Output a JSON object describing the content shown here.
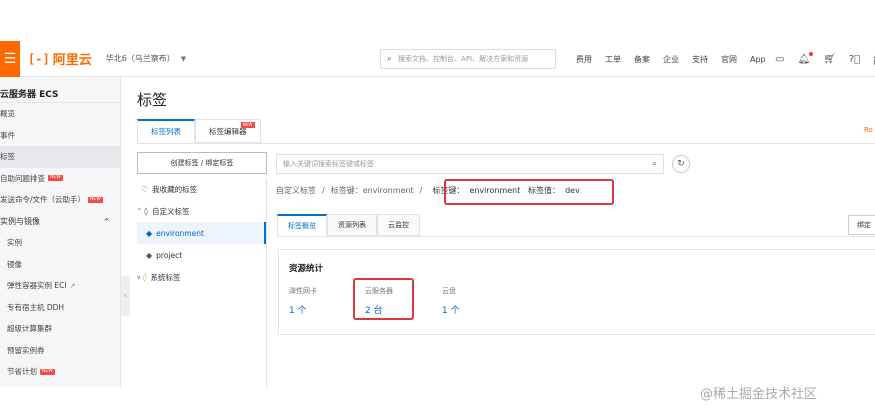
{
  "topbar": {
    "menu_icon": "hamburger-icon",
    "logo_mark": "[-]",
    "logo_text": "阿里云",
    "region": "华北6（乌兰察布）",
    "search_placeholder": "搜索文档、控制台、API、解决方案和资源",
    "links": [
      "费用",
      "工单",
      "备案",
      "企业",
      "支持",
      "官网",
      "App"
    ],
    "icons": [
      "screen-icon",
      "bell-icon",
      "cart-icon",
      "help-icon"
    ],
    "lang": "简"
  },
  "sidebar": {
    "title": "云服务器 ECS",
    "items": [
      {
        "label": "概览"
      },
      {
        "label": "事件"
      },
      {
        "label": "标签",
        "active": true
      },
      {
        "label": "自助问题排查",
        "badge": "NEW"
      },
      {
        "label": "发送命令/文件（云助手）",
        "badge": "NEW"
      }
    ],
    "group": {
      "label": "实例与镜像",
      "caret": "^"
    },
    "sub_items": [
      {
        "label": "实例"
      },
      {
        "label": "镜像"
      },
      {
        "label": "弹性容器实例 ECI",
        "ext": "↗"
      },
      {
        "label": "专有宿主机 DDH"
      },
      {
        "label": "超级计算集群"
      },
      {
        "label": "预留实例券"
      },
      {
        "label": "节省计划",
        "badge": "NEW"
      }
    ],
    "collapse_glyph": "‹"
  },
  "main": {
    "title": "标签",
    "tabs": [
      {
        "label": "标签列表",
        "active": true
      },
      {
        "label": "标签编辑器",
        "badge": "NEW"
      }
    ],
    "right_cut": "Ro",
    "create_button": "创建标签 / 绑定标签",
    "tree": [
      {
        "label": "我收藏的标签",
        "icon": "heart-icon"
      },
      {
        "label": "自定义标签",
        "icon": "tag-outline-icon",
        "caret": "^"
      },
      {
        "label": "environment",
        "icon": "tag-icon",
        "active": true
      },
      {
        "label": "project",
        "icon": "tag-icon"
      },
      {
        "label": "系统标签",
        "icon": "tag-outline-icon",
        "caret": "v"
      }
    ],
    "keyword_placeholder": "输入关键词搜索标签键或标签",
    "breadcrumb": {
      "root": "自定义标签",
      "key": "标签键：environment",
      "current": "标签键：  environment   标签值：  dev",
      "sep": "/"
    },
    "sub_tabs": [
      {
        "label": "标签概览",
        "active": true
      },
      {
        "label": "资源列表"
      },
      {
        "label": "云监控"
      }
    ],
    "bind_button": "绑定",
    "stats": {
      "title": "资源统计",
      "items": [
        {
          "label": "弹性网卡",
          "value": "1 个"
        },
        {
          "label": "云服务器",
          "value": "2 台"
        },
        {
          "label": "云盘",
          "value": "1 个"
        }
      ]
    }
  },
  "watermark": "@稀土掘金技术社区"
}
